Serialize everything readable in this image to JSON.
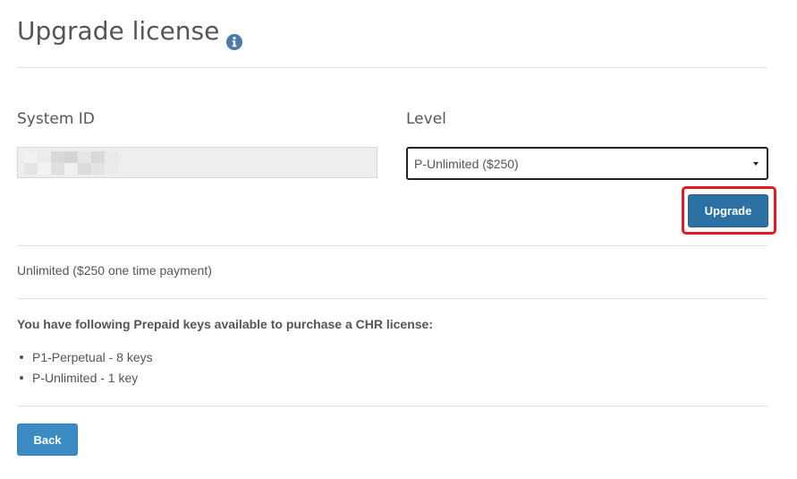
{
  "page": {
    "title": "Upgrade license",
    "info_icon": "info-circle-icon"
  },
  "form": {
    "system_id_label": "System ID",
    "system_id_value_redacted": true,
    "level_label": "Level",
    "level_selected": "P-Unlimited ($250)",
    "upgrade_button": "Upgrade"
  },
  "plan": {
    "description": "Unlimited ($250 one time payment)"
  },
  "prepaid": {
    "heading": "You have following Prepaid keys available to purchase a CHR license:",
    "keys": [
      "P1-Perpetual - 8 keys",
      "P-Unlimited - 1 key"
    ]
  },
  "footer": {
    "back_button": "Back"
  },
  "colors": {
    "upgrade_button": "#2c71a3",
    "back_button": "#3b8cc5",
    "highlight": "#e01b24",
    "text": "#555555"
  }
}
